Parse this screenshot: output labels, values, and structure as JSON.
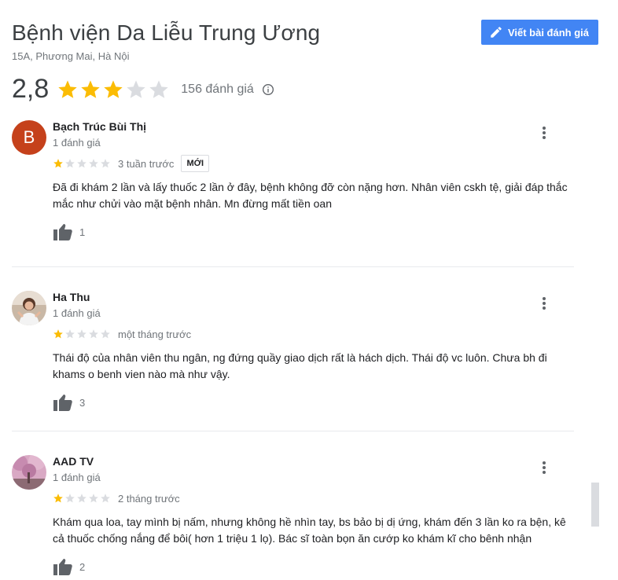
{
  "place": {
    "title": "Bệnh viện Da Liễu Trung Ương",
    "address": "15A, Phương Mai, Hà Nội"
  },
  "write_review": {
    "label": "Viết bài đánh giá",
    "icon": "pencil-icon",
    "color": "#4285f4"
  },
  "summary": {
    "rating": "2,8",
    "stars": 3,
    "count_label": "156 đánh giá",
    "info_icon": "info-icon"
  },
  "colors": {
    "star_filled": "#fbbc04",
    "star_empty": "#dadce0",
    "avatar_b": "#c5411b"
  },
  "reviews": [
    {
      "name": "Bạch Trúc Bùi Thị",
      "avatar_letter": "B",
      "meta": "1 đánh giá",
      "stars": 1,
      "time": "3 tuần trước",
      "badge": "MỚI",
      "text": "Đã đi khám 2 lần và lấy thuốc 2 lần ở đây, bệnh không đỡ còn nặng hơn. Nhân viên cskh tệ, giải đáp thắc mắc như chửi vào mặt bệnh nhân. Mn đừng mất tiền oan",
      "likes": "1"
    },
    {
      "name": "Ha Thu",
      "meta": "1 đánh giá",
      "stars": 1,
      "time": "một tháng trước",
      "text": "Thái độ của nhân viên thu ngân, ng đứng quầy giao dịch rất là hách dịch.  Thái  độ vc luôn. Chưa bh đi khams o benh vien nào mà như vậy.",
      "likes": "3"
    },
    {
      "name": "AAD TV",
      "meta": "1 đánh giá",
      "stars": 1,
      "time": "2 tháng trước",
      "text": "Khám qua loa, tay mình bị nấm, nhưng không hề nhìn tay, bs bảo bị dị ứng, khám đến 3 lần ko ra bện, kê cả thuốc chống nắng để bôi( hơn 1 triệu 1 lọ). Bác sĩ toàn bọn ăn cướp ko khám kĩ cho bênh nhận",
      "likes": "2"
    }
  ]
}
